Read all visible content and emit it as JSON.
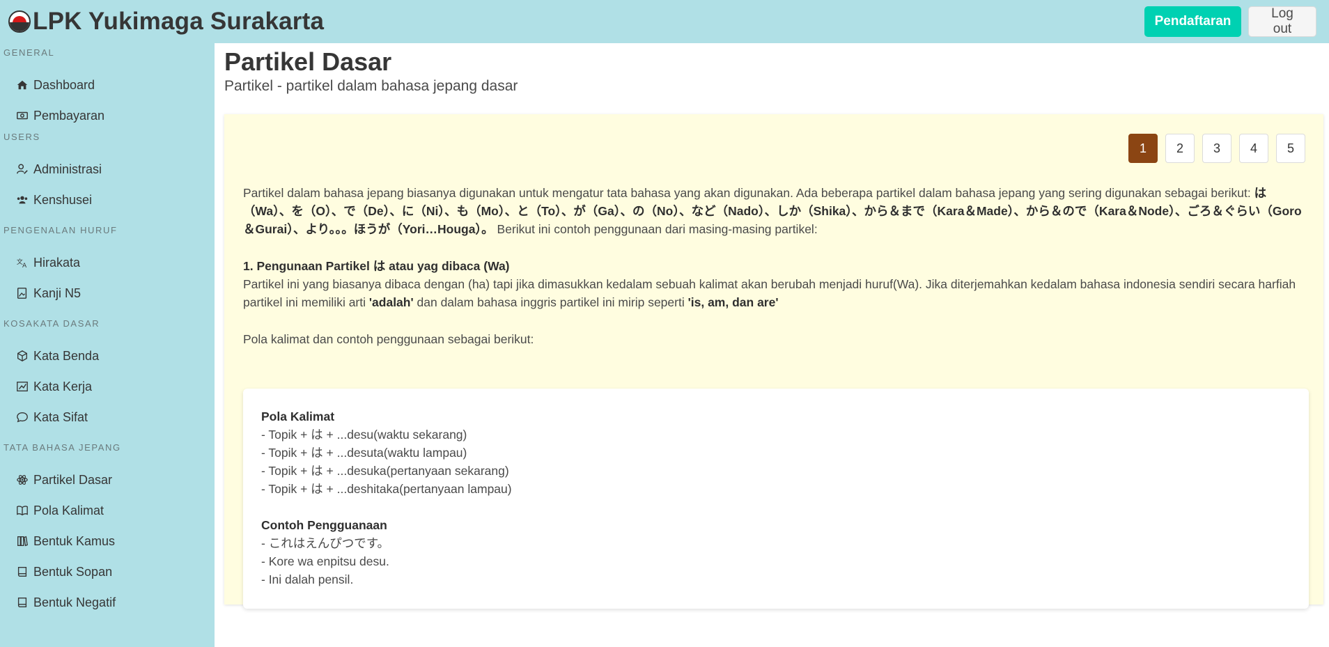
{
  "app": {
    "title": "LPK Yukimaga Surakarta",
    "brand_colors": {
      "navbar": "#b0e0e6",
      "primary": "#00d1b2",
      "active_page": "#8b4513",
      "content_bg": "#fffde0"
    }
  },
  "navbar": {
    "register_label": "Pendaftaran",
    "logout_label": "Log out"
  },
  "sidebar": {
    "sections": [
      {
        "label": "GENERAL",
        "items": [
          {
            "label": "Dashboard",
            "icon": "home-icon"
          },
          {
            "label": "Pembayaran",
            "icon": "money-icon"
          }
        ]
      },
      {
        "label": "USERS",
        "items": [
          {
            "label": "Administrasi",
            "icon": "user-edit-icon"
          },
          {
            "label": "Kenshusei",
            "icon": "users-icon"
          }
        ]
      },
      {
        "label": "PENGENALAN HURUF",
        "items": [
          {
            "label": "Hirakata",
            "icon": "language-icon"
          },
          {
            "label": "Kanji N5",
            "icon": "file-image-icon"
          }
        ]
      },
      {
        "label": "KOSAKATA DASAR",
        "items": [
          {
            "label": "Kata Benda",
            "icon": "box-icon"
          },
          {
            "label": "Kata Kerja",
            "icon": "running-icon"
          },
          {
            "label": "Kata Sifat",
            "icon": "chat-icon"
          }
        ]
      },
      {
        "label": "TATA BAHASA JEPANG",
        "items": [
          {
            "label": "Partikel Dasar",
            "icon": "atom-icon"
          },
          {
            "label": "Pola Kalimat",
            "icon": "book-open-icon"
          },
          {
            "label": "Bentuk Kamus",
            "icon": "books-icon"
          },
          {
            "label": "Bentuk Sopan",
            "icon": "book-icon"
          },
          {
            "label": "Bentuk Negatif",
            "icon": "book-icon"
          }
        ]
      }
    ]
  },
  "main": {
    "title": "Partikel Dasar",
    "subtitle": "Partikel - partikel dalam bahasa jepang dasar",
    "pagination": {
      "pages": [
        "1",
        "2",
        "3",
        "4",
        "5"
      ],
      "current": "1"
    },
    "intro": {
      "text": "Partikel dalam bahasa jepang biasanya digunakan untuk mengatur tata bahasa yang akan digunakan. Ada beberapa partikel dalam bahasa jepang yang sering digunakan sebagai berikut: ",
      "particles": "は（Wa）、を（O）、で（De）、に（Ni）、も（Mo）、と（To）、が（Ga）、の（No）、など（Nado）、しか（Shika）、から＆まで（Kara＆Made）、から＆ので（Kara＆Node）、ごろ＆ぐらい（Goro＆Gurai）、より。。。ほうが（Yori…Houga）。",
      "tail": " Berikut ini contoh penggunaan dari masing-masing partikel:"
    },
    "section1": {
      "heading": "1. Pengunaan Partikel は atau yag dibaca (Wa)",
      "text_a": "Partikel ini yang biasanya dibaca dengan (ha) tapi jika dimasukkan kedalam sebuah kalimat akan berubah menjadi huruf(Wa). Jika diterjemahkan kedalam bahasa indonesia sendiri secara harfiah partikel ini memiliki arti ",
      "bold_a": "'adalah'",
      "text_b": " dan dalam bahasa inggris partikel ini mirip seperti ",
      "bold_b": "'is, am, dan are'"
    },
    "pattern_intro": "Pola kalimat dan contoh penggunaan sebagai berikut:",
    "example_card": {
      "pattern_heading": "Pola Kalimat",
      "patterns": [
        "- Topik + は + ...desu(waktu sekarang)",
        "- Topik + は + ...desuta(waktu lampau)",
        "- Topik + は + ...desuka(pertanyaan sekarang)",
        "- Topik + は + ...deshitaka(pertanyaan lampau)"
      ],
      "usage_heading": "Contoh Pengguanaan",
      "usage": [
        "- これはえんぴつです。",
        "- Kore wa enpitsu desu.",
        "- Ini dalah pensil."
      ]
    }
  }
}
